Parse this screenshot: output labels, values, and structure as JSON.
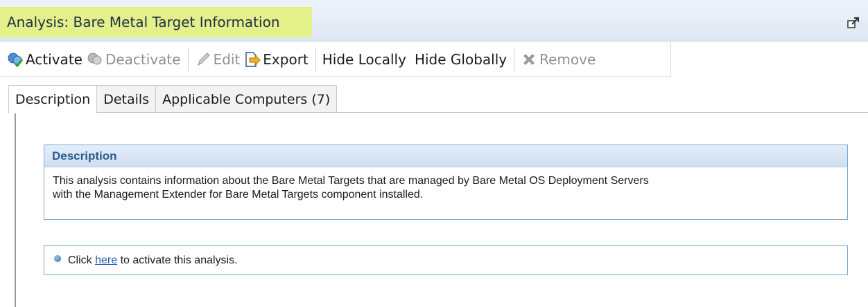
{
  "window": {
    "title": "Analysis: Bare Metal Target  Information",
    "popout_icon": "popout-window-icon"
  },
  "toolbar": {
    "activate": "Activate",
    "deactivate": "Deactivate",
    "edit": "Edit",
    "export": "Export",
    "hide_locally": "Hide Locally",
    "hide_globally": "Hide Globally",
    "remove": "Remove"
  },
  "tabs": [
    {
      "label": "Description",
      "active": true
    },
    {
      "label": "Details",
      "active": false
    },
    {
      "label": "Applicable Computers (7)",
      "active": false
    }
  ],
  "description": {
    "heading": "Description",
    "line1": "This analysis contains information about the Bare Metal Targets that are managed by Bare Metal OS Deployment Servers",
    "line2": "with the Management Extender for Bare Metal Targets component installed."
  },
  "activate_prompt": {
    "before": "Click ",
    "link": "here",
    "after": " to activate this analysis."
  },
  "colors": {
    "title_highlight": "#e4f089",
    "accent_blue": "#2c5a8c",
    "box_border": "#7aa7d6",
    "link": "#2a5db0"
  }
}
